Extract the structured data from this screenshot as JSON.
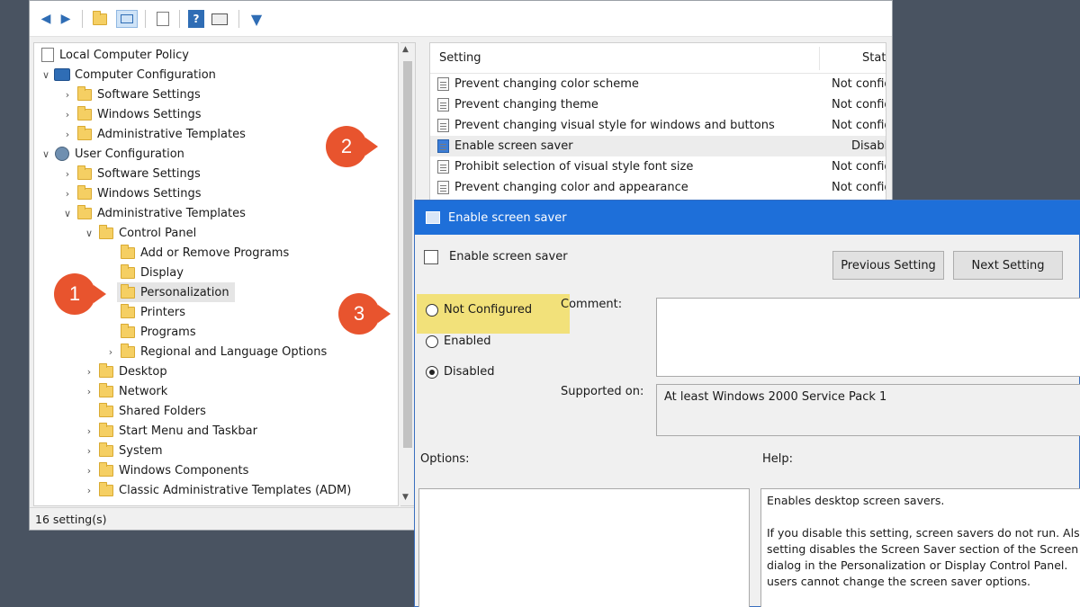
{
  "tree": {
    "items": [
      {
        "label": "Local Computer Policy"
      },
      {
        "label": "Computer Configuration"
      },
      {
        "label": "Software Settings"
      },
      {
        "label": "Windows Settings"
      },
      {
        "label": "Administrative Templates"
      },
      {
        "label": "User Configuration"
      },
      {
        "label": "Software Settings"
      },
      {
        "label": "Windows Settings"
      },
      {
        "label": "Administrative Templates"
      },
      {
        "label": "Control Panel"
      },
      {
        "label": "Add or Remove Programs"
      },
      {
        "label": "Display"
      },
      {
        "label": "Personalization"
      },
      {
        "label": "Printers"
      },
      {
        "label": "Programs"
      },
      {
        "label": "Regional and Language Options"
      },
      {
        "label": "Desktop"
      },
      {
        "label": "Network"
      },
      {
        "label": "Shared Folders"
      },
      {
        "label": "Start Menu and Taskbar"
      },
      {
        "label": "System"
      },
      {
        "label": "Windows Components"
      },
      {
        "label": "Classic Administrative Templates (ADM)"
      }
    ]
  },
  "status": {
    "text": "16 setting(s)"
  },
  "list": {
    "col_setting": "Setting",
    "col_state": "State",
    "rows": [
      {
        "name": "Prevent changing color scheme",
        "state": "Not configure"
      },
      {
        "name": "Prevent changing theme",
        "state": "Not configure"
      },
      {
        "name": "Prevent changing visual style for windows and buttons",
        "state": "Not configure"
      },
      {
        "name": "Enable screen saver",
        "state": "Disabled"
      },
      {
        "name": "Prohibit selection of visual style font size",
        "state": "Not configure"
      },
      {
        "name": "Prevent changing color and appearance",
        "state": "Not configure"
      }
    ]
  },
  "dialog": {
    "title": "Enable screen saver",
    "policy_name": "Enable screen saver",
    "prev_button": "Previous Setting",
    "next_button": "Next Setting",
    "radio_not_configured": "Not Configured",
    "radio_enabled": "Enabled",
    "radio_disabled": "Disabled",
    "selected": "Disabled",
    "comment_label": "Comment:",
    "supported_label": "Supported on:",
    "supported_value": "At least Windows 2000 Service Pack 1",
    "options_label": "Options:",
    "help_label": "Help:",
    "help_lines": [
      "Enables desktop screen savers.",
      "",
      "If you disable this setting, screen savers do not run. Als",
      "setting disables the Screen Saver section of the Screen",
      "dialog in the Personalization or Display Control Panel.",
      "users cannot change the screen saver options."
    ]
  },
  "badges": {
    "one": "1",
    "two": "2",
    "three": "3"
  },
  "colors": {
    "badge": "#e8542e",
    "highlight": "#f2e17a",
    "dialog_title": "#1e6fd9"
  }
}
